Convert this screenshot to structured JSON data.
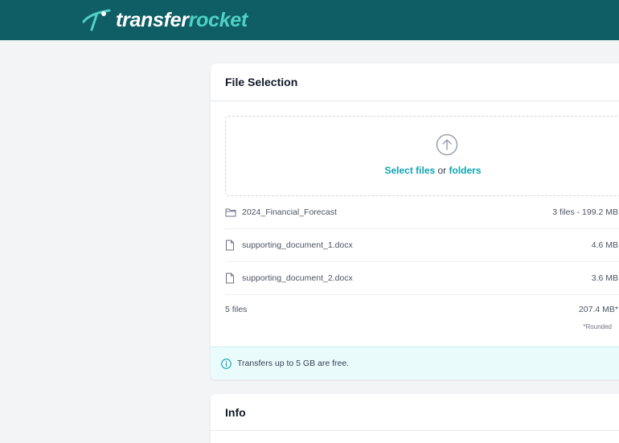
{
  "header": {
    "logo_part1": "transfer",
    "logo_part2": "rocket",
    "brand_color": "#0f5e66",
    "accent_color": "#4fd1c5"
  },
  "file_selection": {
    "title": "File Selection",
    "dropzone": {
      "select_files": "Select files",
      "or": " or ",
      "folders": "folders",
      "icon": "upload-arrow-icon"
    },
    "items": [
      {
        "icon": "folder-icon",
        "name": "2024_Financial_Forecast",
        "size": "3 files - 199.2 MB"
      },
      {
        "icon": "file-icon",
        "name": "supporting_document_1.docx",
        "size": "4.6 MB"
      },
      {
        "icon": "file-icon",
        "name": "supporting_document_2.docx",
        "size": "3.6 MB"
      }
    ],
    "total_count": "5 files",
    "total_size": "207.4 MB*",
    "rounded_note": "*Rounded",
    "notice": "Transfers up to 5 GB are free."
  },
  "info": {
    "title": "Info"
  }
}
